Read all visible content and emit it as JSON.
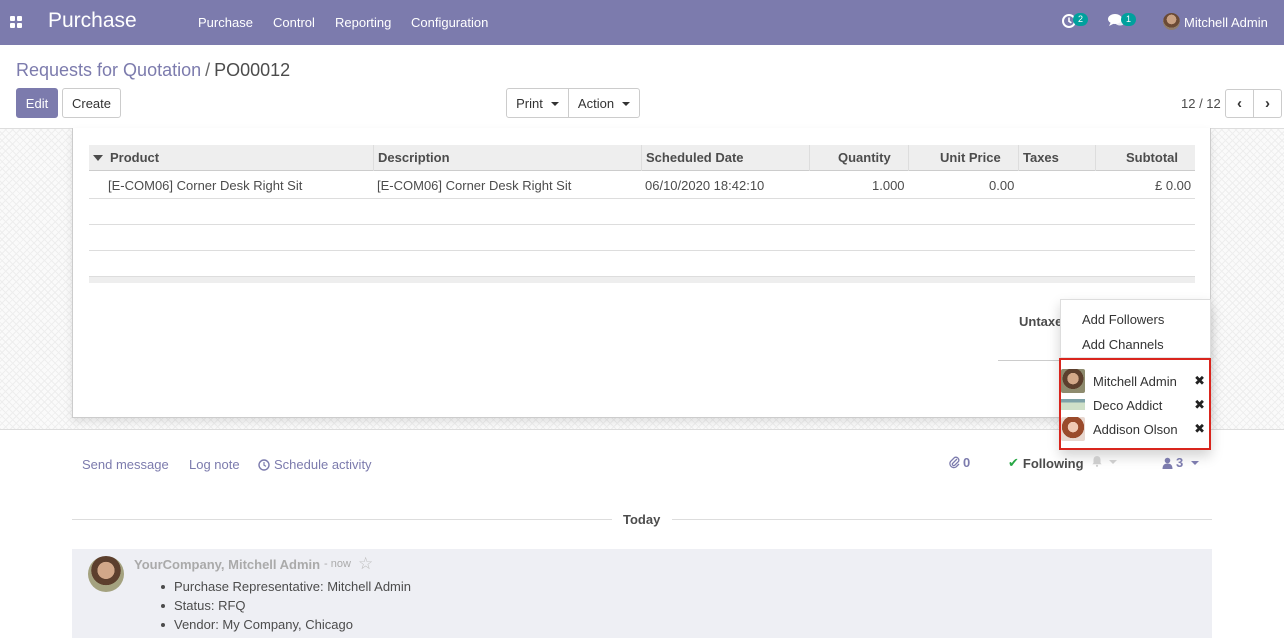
{
  "navbar": {
    "app_name": "Purchase",
    "menu": [
      "Purchase",
      "Control",
      "Reporting",
      "Configuration"
    ],
    "activity_count": "2",
    "message_count": "1",
    "user_name": "Mitchell Admin",
    "bg_color": "#7c7bad"
  },
  "breadcrumb": {
    "parent": "Requests for Quotation",
    "separator": "/",
    "current": "PO00012"
  },
  "buttons": {
    "edit": "Edit",
    "create": "Create",
    "print": "Print",
    "action": "Action"
  },
  "pager": {
    "value": "12 / 12",
    "prev_icon": "chevron-left-icon",
    "next_icon": "chevron-right-icon"
  },
  "order_lines": {
    "columns": [
      "Product",
      "Description",
      "Scheduled Date",
      "Quantity",
      "Unit Price",
      "Taxes",
      "Subtotal"
    ],
    "rows": [
      {
        "product": "[E-COM06] Corner Desk Right Sit",
        "description": "[E-COM06] Corner Desk Right Sit",
        "scheduled_date": "06/10/2020 18:42:10",
        "quantity": "1.000",
        "unit_price": "0.00",
        "taxes": "",
        "subtotal": "£ 0.00"
      }
    ]
  },
  "totals": {
    "untaxed_label": "Untaxe"
  },
  "followers_dropdown": {
    "add_followers": "Add Followers",
    "add_channels": "Add Channels",
    "followers": [
      {
        "name": "Mitchell Admin",
        "remove_icon": "close-icon"
      },
      {
        "name": "Deco Addict",
        "remove_icon": "close-icon"
      },
      {
        "name": "Addison Olson",
        "remove_icon": "close-icon"
      }
    ],
    "highlight_color": "#d9251d"
  },
  "chatter": {
    "send_message": "Send message",
    "log_note": "Log note",
    "schedule_activity": "Schedule activity",
    "attachments_count": "0",
    "following": "Following",
    "followers_count": "3",
    "date_separator": "Today",
    "message": {
      "author": "YourCompany, Mitchell Admin",
      "time": "- now",
      "tracking": [
        "Purchase Representative: Mitchell Admin",
        "Status: RFQ",
        "Vendor: My Company, Chicago"
      ]
    }
  }
}
